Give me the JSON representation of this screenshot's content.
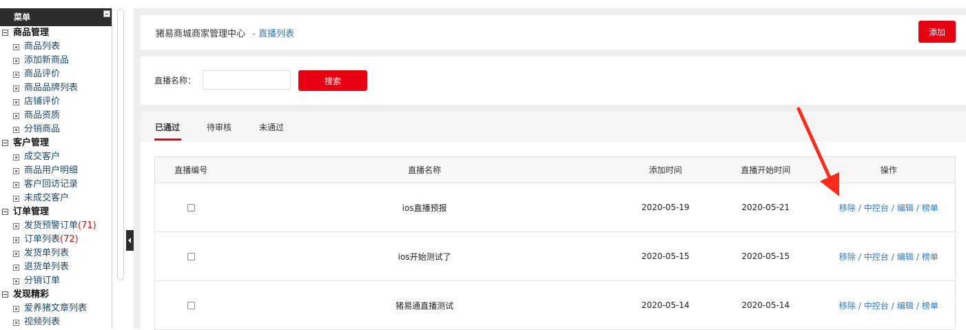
{
  "sidebar": {
    "title": "菜单",
    "groups": [
      {
        "label": "商品管理",
        "items": [
          {
            "label": "商品列表"
          },
          {
            "label": "添加新商品"
          },
          {
            "label": "商品评价"
          },
          {
            "label": "商品品牌列表"
          },
          {
            "label": "店铺评价"
          },
          {
            "label": "商品资质"
          },
          {
            "label": "分销商品"
          }
        ]
      },
      {
        "label": "客户管理",
        "items": [
          {
            "label": "成交客户"
          },
          {
            "label": "商品用户明细"
          },
          {
            "label": "客户回访记录"
          },
          {
            "label": "未成交客户"
          }
        ]
      },
      {
        "label": "订单管理",
        "items": [
          {
            "label": "发货预警订单",
            "count": "(71)"
          },
          {
            "label": "订单列表",
            "count": "(72)"
          },
          {
            "label": "发货单列表"
          },
          {
            "label": "退货单列表"
          },
          {
            "label": "分销订单"
          }
        ]
      },
      {
        "label": "发现精彩",
        "items": [
          {
            "label": "爱养猪文章列表"
          },
          {
            "label": "视频列表"
          }
        ]
      }
    ]
  },
  "header": {
    "title": "猪易商城商家管理中心",
    "breadcrumb_link": "- 直播列表",
    "add_label": "添加"
  },
  "search": {
    "label": "直播名称：",
    "value": "",
    "button_label": "搜索"
  },
  "tabs": [
    {
      "label": "已通过",
      "active": true
    },
    {
      "label": "待审核",
      "active": false
    },
    {
      "label": "未通过",
      "active": false
    }
  ],
  "table": {
    "columns": [
      "直播编号",
      "直播名称",
      "添加时间",
      "直播开始时间",
      "操作"
    ],
    "rows": [
      {
        "name": "ios直播预报",
        "added": "2020-05-19",
        "start": "2020-05-21"
      },
      {
        "name": "ios开始测试了",
        "added": "2020-05-15",
        "start": "2020-05-15"
      },
      {
        "name": "猪易通直播测试",
        "added": "2020-05-14",
        "start": "2020-05-14"
      }
    ],
    "actions": [
      "移除",
      "中控台",
      "编辑",
      "榜单"
    ],
    "action_separator": "/"
  },
  "colors": {
    "accent": "#e60012",
    "link": "#2f7ac9",
    "annotation_arrow": "#ff2a1a",
    "sidebar_header": "#2d2d2d"
  }
}
